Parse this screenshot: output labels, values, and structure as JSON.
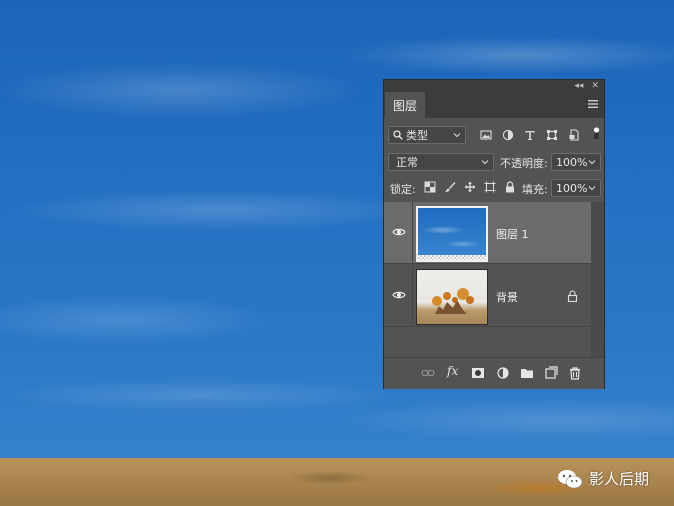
{
  "panel": {
    "tab_label": "图层",
    "filter": {
      "value": "类型",
      "icons": [
        "image-filter-icon",
        "adjustment-filter-icon",
        "type-filter-icon",
        "shape-filter-icon",
        "smart-object-filter-icon",
        "filter-toggle-icon"
      ]
    },
    "blend_mode": "正常",
    "opacity_label": "不透明度:",
    "opacity_value": "100%",
    "lock_label": "锁定:",
    "fill_label": "填充:",
    "fill_value": "100%",
    "layers": [
      {
        "name": "图层 1",
        "visible": true,
        "selected": true,
        "locked": false
      },
      {
        "name": "背景",
        "visible": true,
        "selected": false,
        "locked": true
      }
    ],
    "footer_icons": [
      "link-layers-icon",
      "fx-icon",
      "add-mask-icon",
      "adjustment-layer-icon",
      "new-group-icon",
      "new-layer-icon",
      "delete-layer-icon"
    ],
    "fx_label": "fx"
  },
  "watermark": {
    "text": "影人后期"
  },
  "colors": {
    "panel_bg": "#535353",
    "panel_dark": "#3c3c3c",
    "selected_row": "#6b6b6b",
    "sky": "#236fc2"
  }
}
